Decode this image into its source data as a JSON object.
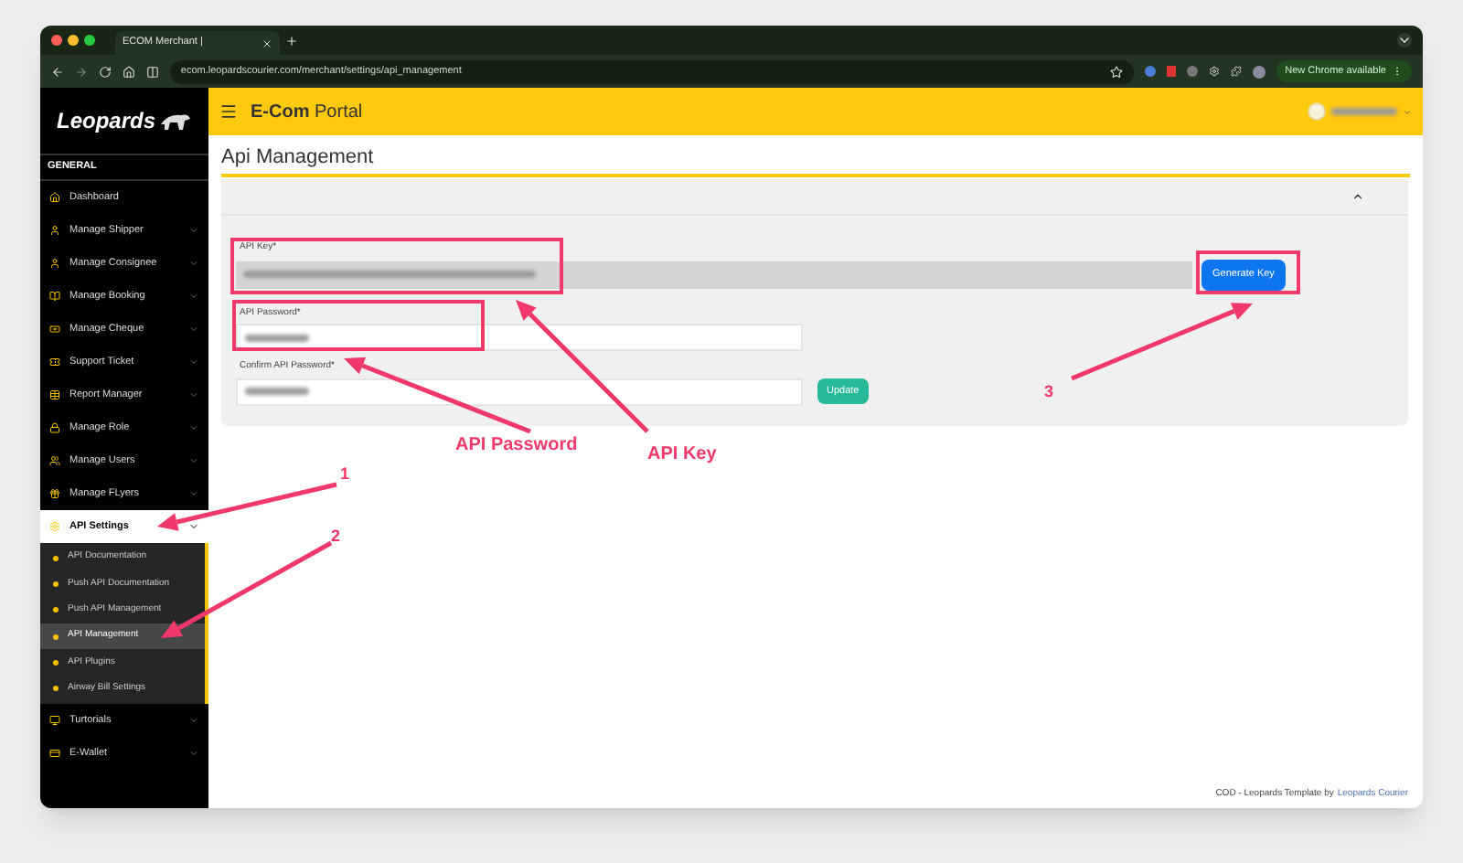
{
  "browser": {
    "tab_title": "ECOM Merchant |",
    "url": "ecom.leopardscourier.com/merchant/settings/api_management",
    "update_badge": "New Chrome available"
  },
  "header": {
    "title": "**E-Com** Portal"
  },
  "sidebar": {
    "logo": "Leopards",
    "section": "GENERAL",
    "items": [
      {
        "label": "Dashboard",
        "has_submenu": false,
        "expanded": false
      },
      {
        "label": "Manage Shipper",
        "has_submenu": true,
        "expanded": false
      },
      {
        "label": "Manage Consignee",
        "has_submenu": true,
        "expanded": false
      },
      {
        "label": "Manage Booking",
        "has_submenu": true,
        "expanded": false
      },
      {
        "label": "Manage Cheque",
        "has_submenu": true,
        "expanded": false
      },
      {
        "label": "Support Ticket",
        "has_submenu": true,
        "expanded": false
      },
      {
        "label": "Report Manager",
        "has_submenu": true,
        "expanded": false
      },
      {
        "label": "Manage Role",
        "has_submenu": true,
        "expanded": false
      },
      {
        "label": "Manage Users",
        "has_submenu": true,
        "expanded": false
      },
      {
        "label": "Manage FLyers",
        "has_submenu": true,
        "expanded": false
      },
      {
        "label": "API Settings",
        "has_submenu": true,
        "expanded": true,
        "children": [
          {
            "label": "API Documentation",
            "selected": false
          },
          {
            "label": "Push API Documentation",
            "selected": false
          },
          {
            "label": "Push API Management",
            "selected": false
          },
          {
            "label": "API Management",
            "selected": true
          },
          {
            "label": "API Plugins",
            "selected": false
          },
          {
            "label": "Airway Bill Settings",
            "selected": false
          }
        ]
      },
      {
        "label": "Turtorials",
        "has_submenu": true,
        "expanded": false
      },
      {
        "label": "E-Wallet",
        "has_submenu": true,
        "expanded": false
      }
    ]
  },
  "page": {
    "title": "Api Management",
    "api_key_label": "API Key*",
    "generate_button": "Generate Key",
    "password_label": "API Password*",
    "confirm_label": "Confirm API Password*",
    "update_button": "Update"
  },
  "footer": {
    "text": "COD - Leopards Template by",
    "link": "Leopards Courier"
  },
  "callouts": [
    {
      "text": "1"
    },
    {
      "text": "2"
    },
    {
      "text": "API Password"
    },
    {
      "text": "API Key"
    },
    {
      "text": "3"
    }
  ]
}
